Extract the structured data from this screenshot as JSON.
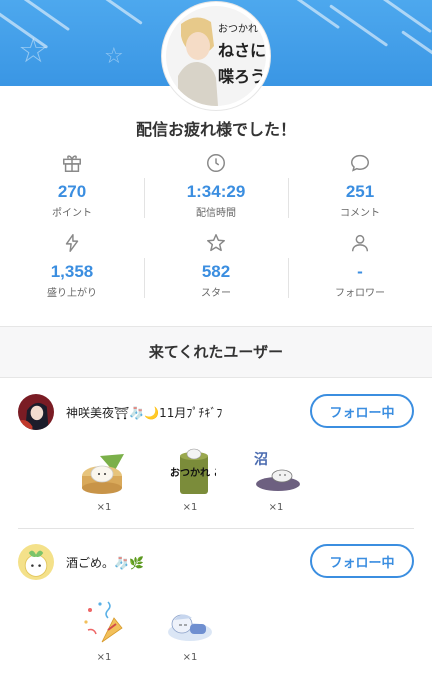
{
  "header": {
    "colors": {
      "banner": "#4da8ee",
      "accent": "#3b8ee0"
    },
    "avatar_text": [
      "おつかれ",
      "ねさに",
      "喋ろう"
    ]
  },
  "title": "配信お疲れ様でした！",
  "stats": [
    {
      "icon": "gift-icon",
      "value": "270",
      "label": "ポイント"
    },
    {
      "icon": "clock-icon",
      "value": "1:34:29",
      "label": "配信時間"
    },
    {
      "icon": "comment-icon",
      "value": "251",
      "label": "コメント"
    },
    {
      "icon": "lightning-icon",
      "value": "1,358",
      "label": "盛り上がり"
    },
    {
      "icon": "star-icon",
      "value": "582",
      "label": "スター"
    },
    {
      "icon": "person-icon",
      "value": "-",
      "label": "フォロワー"
    }
  ],
  "visitors_heading": "来てくれたユーザー",
  "users": [
    {
      "name": "神咲美夜⛩🧦🌙11月ﾌﾟﾁｷﾞﾌ",
      "follow_label": "フォロー中",
      "gifts": [
        {
          "icon": "dumpling-steamer-icon",
          "count": "×1"
        },
        {
          "icon": "otsukare-goma-icon",
          "count": "×1",
          "text": "おつかれ ごま"
        },
        {
          "icon": "swamp-creature-icon",
          "count": "×1",
          "text": "沼"
        }
      ]
    },
    {
      "name": "酒ごめ。🧦🌿",
      "follow_label": "フォロー中",
      "gifts": [
        {
          "icon": "party-popper-icon",
          "count": "×1"
        },
        {
          "icon": "sleeping-character-icon",
          "count": "×1"
        }
      ]
    }
  ]
}
